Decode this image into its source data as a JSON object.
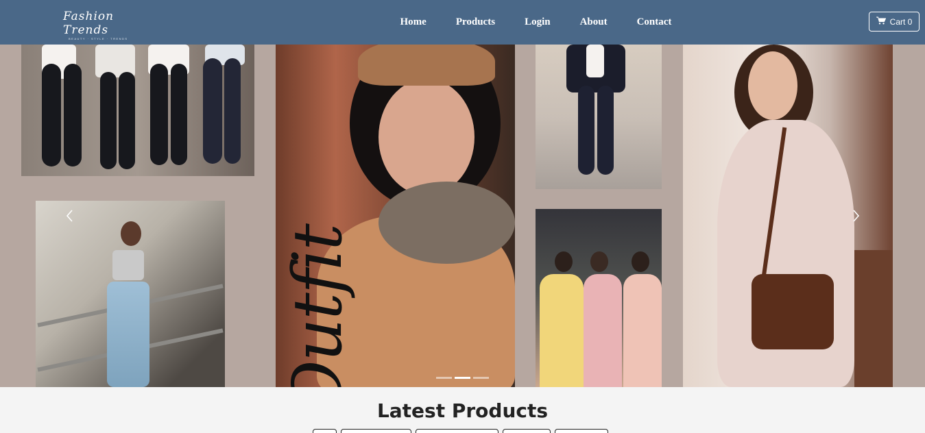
{
  "brand": {
    "title": "Fashion Trends",
    "subtitle": "BEAUTY · STYLE · TRENDS"
  },
  "nav": {
    "links": [
      {
        "label": "Home"
      },
      {
        "label": "Products"
      },
      {
        "label": "Login"
      },
      {
        "label": "About"
      },
      {
        "label": "Contact"
      }
    ],
    "cart": {
      "label": "Cart 0",
      "icon": "shopping-cart-icon"
    }
  },
  "hero": {
    "overlay_word": "Outfit",
    "prev_icon": "chevron-left-icon",
    "next_icon": "chevron-right-icon",
    "slide_count": 3,
    "active_slide": 2
  },
  "products": {
    "title": "Latest Products",
    "filter_buttons": [
      "",
      "",
      "",
      "",
      ""
    ]
  },
  "colors": {
    "navbar": "#4a6888",
    "page_bg": "#f4f4f4",
    "hero_bg": "#b6a7a0"
  }
}
